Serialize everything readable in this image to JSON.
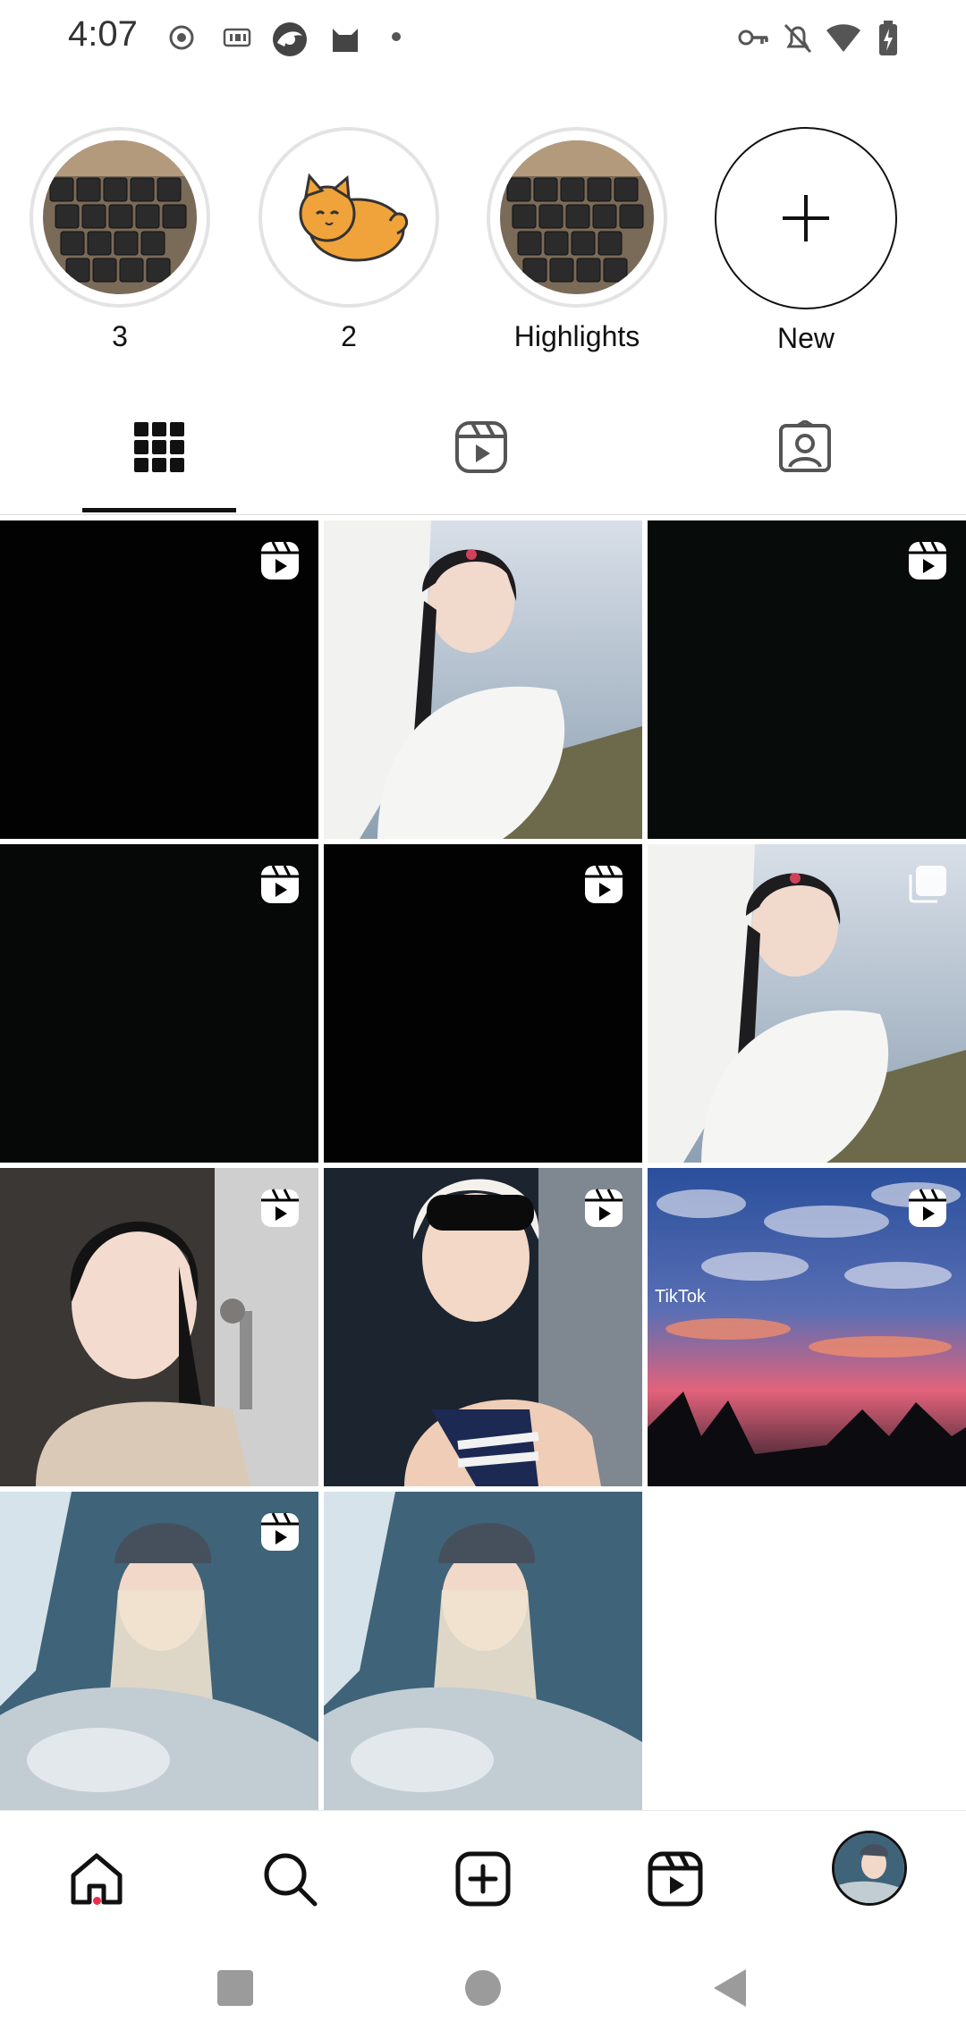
{
  "status_bar": {
    "time": "4:07",
    "left_icons": [
      "record-icon",
      "iqiyi-icon",
      "browser-icon",
      "cat-app-icon",
      "dot-icon"
    ],
    "right_icons": [
      "vpn-key-icon",
      "bell-off-icon",
      "wifi-icon",
      "battery-charging-icon"
    ]
  },
  "highlights": [
    {
      "label": "3",
      "thumb": "keyboard"
    },
    {
      "label": "2",
      "thumb": "cat"
    },
    {
      "label": "Highlights",
      "thumb": "keyboard"
    },
    {
      "label": "New",
      "thumb": "plus"
    }
  ],
  "profile_tabs": [
    {
      "name": "grid-tab",
      "icon": "grid-icon",
      "selected": true
    },
    {
      "name": "reels-tab",
      "icon": "reels-icon",
      "selected": false
    },
    {
      "name": "tagged-tab",
      "icon": "tagged-user-icon",
      "selected": false
    }
  ],
  "posts": [
    {
      "type": "reel",
      "thumb": "black"
    },
    {
      "type": "photo",
      "thumb": "girl-white-coat"
    },
    {
      "type": "reel",
      "thumb": "dark-green"
    },
    {
      "type": "reel",
      "thumb": "dark-green"
    },
    {
      "type": "reel",
      "thumb": "black"
    },
    {
      "type": "carousel",
      "thumb": "girl-white-coat"
    },
    {
      "type": "reel",
      "thumb": "girl-makeup-brush"
    },
    {
      "type": "reel",
      "thumb": "girl-sunglasses-bonnet"
    },
    {
      "type": "reel",
      "thumb": "sunset-sky",
      "overlay_text": "TikTok"
    },
    {
      "type": "reel",
      "thumb": "girl-in-car"
    },
    {
      "type": "photo",
      "thumb": "girl-in-car"
    }
  ],
  "bottom_nav": [
    {
      "name": "home",
      "icon": "home-icon",
      "active": true
    },
    {
      "name": "search",
      "icon": "search-icon"
    },
    {
      "name": "create",
      "icon": "add-post-icon"
    },
    {
      "name": "reels",
      "icon": "reels-icon"
    },
    {
      "name": "profile",
      "icon": "profile-avatar"
    }
  ],
  "colors": {
    "notification_dot": "#ed2d47",
    "tab_indicator": "#111111"
  }
}
